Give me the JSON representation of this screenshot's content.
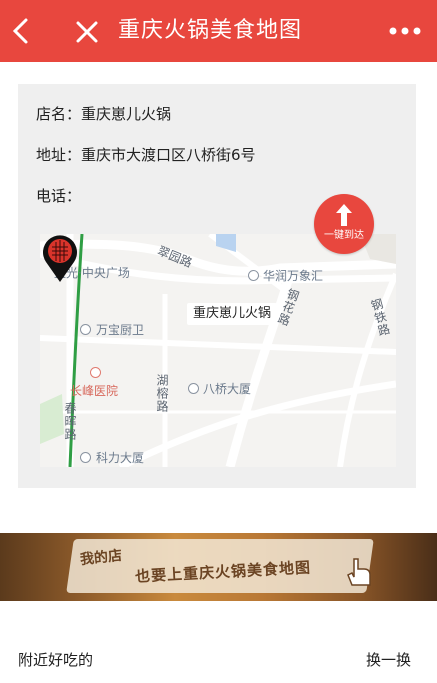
{
  "header": {
    "title": "重庆火锅美食地图",
    "back_icon": "chevron-left-icon",
    "close_icon": "close-icon",
    "more_icon": "more-dots-icon",
    "bg_color": "#e8473e"
  },
  "store": {
    "name_label": "店名：",
    "name": "重庆崽儿火锅",
    "address_label": "地址：",
    "address": "重庆市大渡口区八桥街6号",
    "phone_label": "电话：",
    "phone": ""
  },
  "map": {
    "marker_title": "重庆崽儿火锅",
    "navigate_label": "一键到达",
    "places": {
      "cuiyuan_road": "翠园路",
      "languang": "蓝光·中央广场",
      "huarun": "华润万象汇",
      "gangtie_road": "钢铁路",
      "ganghua_road": "钢花路",
      "wanbao": "万宝厨卫",
      "changfeng": "长峰医院",
      "hurong_road": "湖榕路",
      "baqiao": "八桥大厦",
      "chunhui_road": "春晖路",
      "lili": "科力大厦"
    }
  },
  "banner": {
    "line1": "我的店",
    "line2": "也要上重庆火锅美食地图"
  },
  "nearby": {
    "title": "附近好吃的",
    "refresh": "换一换"
  }
}
